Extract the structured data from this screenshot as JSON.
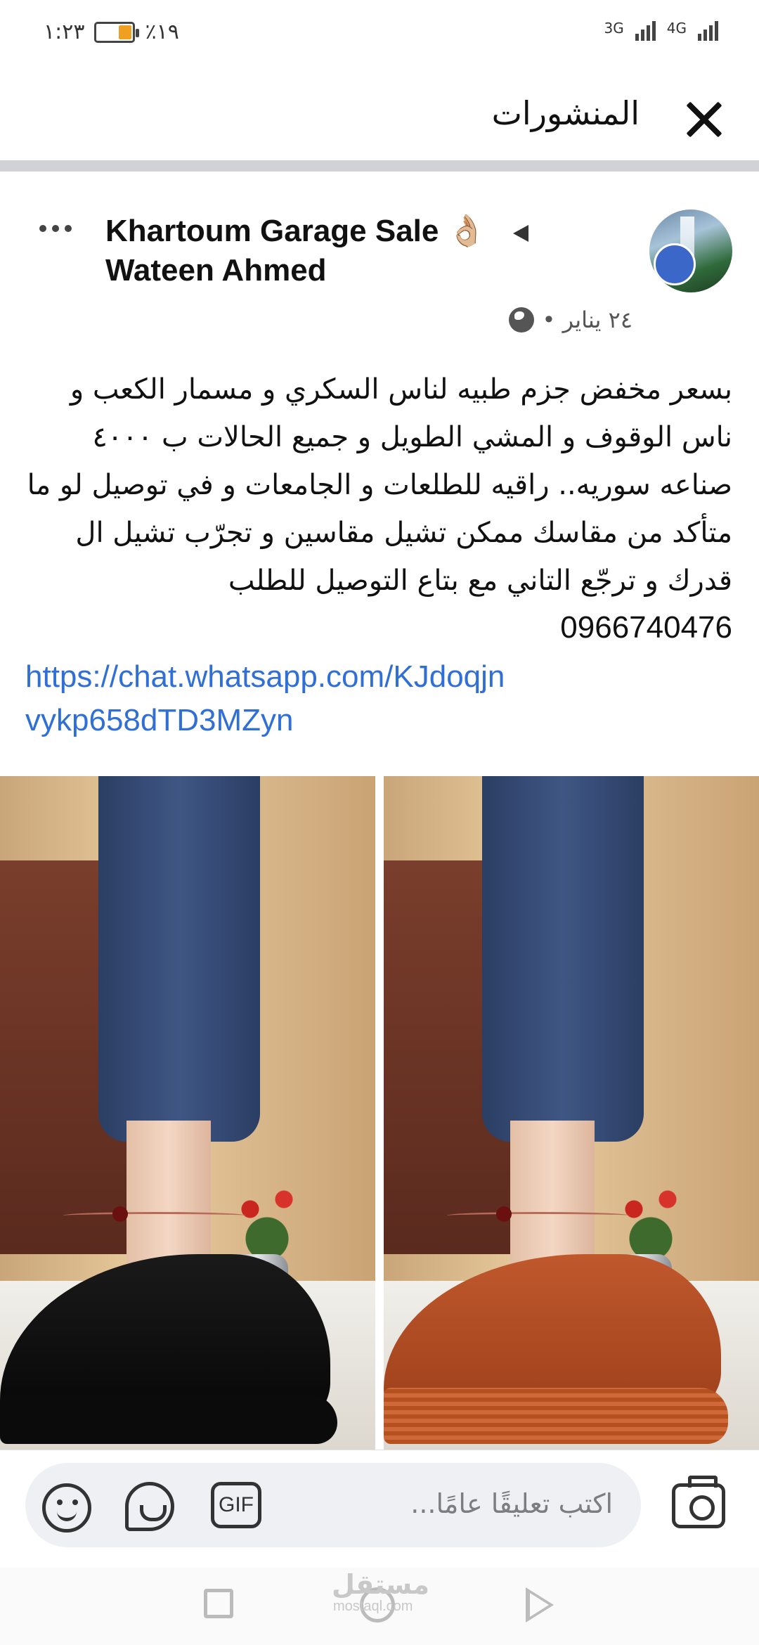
{
  "status_bar": {
    "time": "١:٢٣",
    "battery": "٪١٩",
    "network_1": "3G",
    "network_2": "4G"
  },
  "header": {
    "title": "المنشورات"
  },
  "post": {
    "group_name": "Khartoum Garage Sale 👌🏼",
    "author_name": "Wateen Ahmed",
    "date": "٢٤ يناير •",
    "text": "بسعر مخفض جزم طبيه لناس السكري و مسمار الكعب و ناس الوقوف و المشي الطويل و جميع الحالات ب ٤٠٠٠ صناعه سوريه.. راقيه للطلعات و الجامعات و في توصيل لو ما متأكد من مقاسك ممكن تشيل مقاسين و تجرّب تشيل ال قدرك و ترجّع التاني مع بتاع التوصيل للطلب",
    "phone": "0966740476",
    "link": "https://chat.whatsapp.com/KJdoqjnvykp658dTD3MZyn"
  },
  "comment_bar": {
    "placeholder": "اكتب تعليقًا عامًا...",
    "gif_label": "GIF"
  },
  "watermark": {
    "text": "مستقل",
    "sub": "mostaql.com"
  },
  "icons": {
    "close": "close-icon",
    "more": "more-options-icon",
    "globe": "globe-icon",
    "emoji": "emoji-icon",
    "sticker": "sticker-icon",
    "gif": "gif-icon",
    "camera": "camera-icon"
  }
}
